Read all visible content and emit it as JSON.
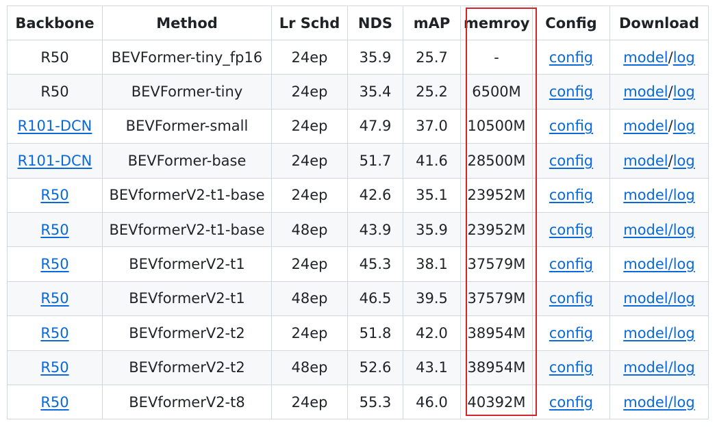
{
  "table": {
    "headers": [
      "Backbone",
      "Method",
      "Lr Schd",
      "NDS",
      "mAP",
      "memroy",
      "Config",
      "Download"
    ],
    "rows": [
      {
        "backbone": "R50",
        "backbone_link": false,
        "method": "BEVFormer-tiny_fp16",
        "lr": "24ep",
        "nds": "35.9",
        "map": "25.7",
        "mem": "-",
        "config": "config",
        "model": "model",
        "sep": "/",
        "log": "log"
      },
      {
        "backbone": "R50",
        "backbone_link": false,
        "method": "BEVFormer-tiny",
        "lr": "24ep",
        "nds": "35.4",
        "map": "25.2",
        "mem": "6500M",
        "config": "config",
        "model": "model",
        "sep": "/",
        "log": "log"
      },
      {
        "backbone": "R101-DCN",
        "backbone_link": true,
        "method": "BEVFormer-small",
        "lr": "24ep",
        "nds": "47.9",
        "map": "37.0",
        "mem": "10500M",
        "config": "config",
        "model": "model",
        "sep": "/",
        "log": "log"
      },
      {
        "backbone": "R101-DCN",
        "backbone_link": true,
        "method": "BEVFormer-base",
        "lr": "24ep",
        "nds": "51.7",
        "map": "41.6",
        "mem": "28500M",
        "config": "config",
        "model": "model",
        "sep": "/",
        "log": "log"
      },
      {
        "backbone": "R50",
        "backbone_link": true,
        "method": "BEVformerV2-t1-base",
        "lr": "24ep",
        "nds": "42.6",
        "map": "35.1",
        "mem": "23952M",
        "config": "config",
        "model": "model/log",
        "sep": "",
        "log": ""
      },
      {
        "backbone": "R50",
        "backbone_link": true,
        "method": "BEVformerV2-t1-base",
        "lr": "48ep",
        "nds": "43.9",
        "map": "35.9",
        "mem": "23952M",
        "config": "config",
        "model": "model/log",
        "sep": "",
        "log": ""
      },
      {
        "backbone": "R50",
        "backbone_link": true,
        "method": "BEVformerV2-t1",
        "lr": "24ep",
        "nds": "45.3",
        "map": "38.1",
        "mem": "37579M",
        "config": "config",
        "model": "model/log",
        "sep": "",
        "log": ""
      },
      {
        "backbone": "R50",
        "backbone_link": true,
        "method": "BEVformerV2-t1",
        "lr": "48ep",
        "nds": "46.5",
        "map": "39.5",
        "mem": "37579M",
        "config": "config",
        "model": "model/log",
        "sep": "",
        "log": ""
      },
      {
        "backbone": "R50",
        "backbone_link": true,
        "method": "BEVformerV2-t2",
        "lr": "24ep",
        "nds": "51.8",
        "map": "42.0",
        "mem": "38954M",
        "config": "config",
        "model": "model/log",
        "sep": "",
        "log": ""
      },
      {
        "backbone": "R50",
        "backbone_link": true,
        "method": "BEVformerV2-t2",
        "lr": "48ep",
        "nds": "52.6",
        "map": "43.1",
        "mem": "38954M",
        "config": "config",
        "model": "model/log",
        "sep": "",
        "log": ""
      },
      {
        "backbone": "R50",
        "backbone_link": true,
        "method": "BEVformerV2-t8",
        "lr": "24ep",
        "nds": "55.3",
        "map": "46.0",
        "mem": "40392M",
        "config": "config",
        "model": "model/log",
        "sep": "",
        "log": ""
      }
    ]
  },
  "colors": {
    "link": "#0969da",
    "highlight": "#d0262b",
    "border": "#d0d7de",
    "stripe": "#f6f8fa"
  }
}
